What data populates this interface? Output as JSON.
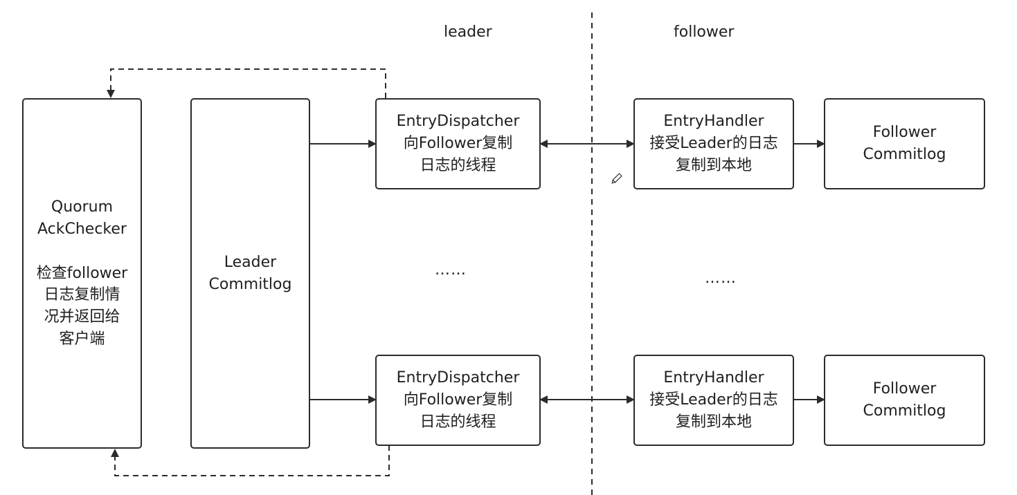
{
  "labels": {
    "leader": "leader",
    "follower": "follower"
  },
  "boxes": {
    "quorum": "Quorum\nAckChecker\n\n检查follower\n日志复制情\n况并返回给\n客户端",
    "leader_commitlog": "Leader\nCommitlog",
    "dispatcher_top": "EntryDispatcher\n向Follower复制\n日志的线程",
    "dispatcher_bottom": "EntryDispatcher\n向Follower复制\n日志的线程",
    "handler_top": "EntryHandler\n接受Leader的日志\n复制到本地",
    "handler_bottom": "EntryHandler\n接受Leader的日志\n复制到本地",
    "follower_commitlog_top": "Follower\nCommitlog",
    "follower_commitlog_bottom": "Follower\nCommitlog"
  },
  "ellipsis": {
    "leader": "……",
    "follower": "……"
  },
  "icons": {
    "pencil": "pencil-icon"
  }
}
